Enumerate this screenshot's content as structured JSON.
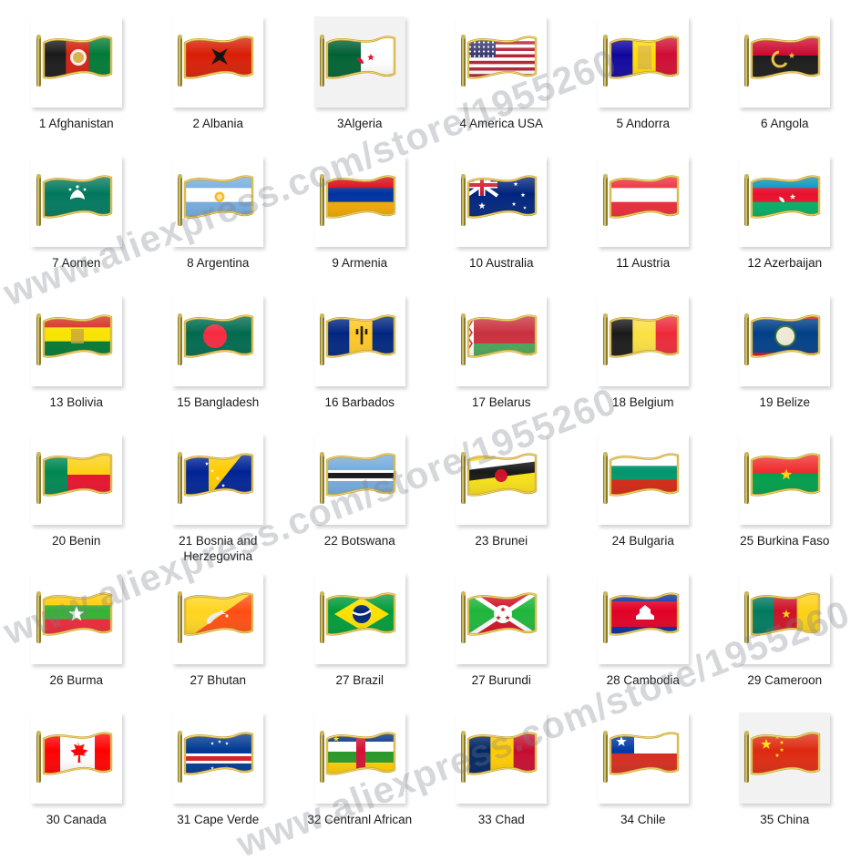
{
  "page": {
    "title": "Flag Lapel Pin Catalog",
    "columns": 6,
    "rows": 6,
    "tile_background": "#ffffff",
    "label_color": "#1b1b1b",
    "page_background": "#ffffff"
  },
  "watermark": {
    "text": "www.aliexpress.com/store/1955260",
    "color": "#7b7e8c",
    "opacity": "0.30",
    "angle_degrees": -21,
    "repetitions": 3
  },
  "items": [
    {
      "number": "1",
      "name": "Afghanistan",
      "label": "1 Afghanistan",
      "tint": false,
      "flag": "afghanistan"
    },
    {
      "number": "2",
      "name": "Albania",
      "label": "2 Albania",
      "tint": false,
      "flag": "albania"
    },
    {
      "number": "3",
      "name": "Algeria",
      "label": "3Algeria",
      "tint": true,
      "flag": "algeria"
    },
    {
      "number": "4",
      "name": "America USA",
      "label": "4 America USA",
      "tint": false,
      "flag": "usa"
    },
    {
      "number": "5",
      "name": "Andorra",
      "label": "5 Andorra",
      "tint": false,
      "flag": "andorra"
    },
    {
      "number": "6",
      "name": "Angola",
      "label": "6 Angola",
      "tint": false,
      "flag": "angola"
    },
    {
      "number": "7",
      "name": "Aomen",
      "label": "7 Aomen",
      "tint": false,
      "flag": "macau"
    },
    {
      "number": "8",
      "name": "Argentina",
      "label": "8 Argentina",
      "tint": false,
      "flag": "argentina"
    },
    {
      "number": "9",
      "name": "Armenia",
      "label": "9 Armenia",
      "tint": false,
      "flag": "armenia"
    },
    {
      "number": "10",
      "name": "Australia",
      "label": "10 Australia",
      "tint": false,
      "flag": "australia"
    },
    {
      "number": "11",
      "name": "Austria",
      "label": "11 Austria",
      "tint": false,
      "flag": "austria"
    },
    {
      "number": "12",
      "name": "Azerbaijan",
      "label": "12 Azerbaijan",
      "tint": false,
      "flag": "azerbaijan"
    },
    {
      "number": "13",
      "name": "Bolivia",
      "label": "13 Bolivia",
      "tint": false,
      "flag": "bolivia"
    },
    {
      "number": "15",
      "name": "Bangladesh",
      "label": "15 Bangladesh",
      "tint": false,
      "flag": "bangladesh"
    },
    {
      "number": "16",
      "name": "Barbados",
      "label": "16 Barbados",
      "tint": false,
      "flag": "barbados"
    },
    {
      "number": "17",
      "name": "Belarus",
      "label": "17 Belarus",
      "tint": false,
      "flag": "belarus"
    },
    {
      "number": "18",
      "name": "Belgium",
      "label": "18 Belgium",
      "tint": false,
      "flag": "belgium"
    },
    {
      "number": "19",
      "name": "Belize",
      "label": "19 Belize",
      "tint": false,
      "flag": "belize"
    },
    {
      "number": "20",
      "name": "Benin",
      "label": "20 Benin",
      "tint": false,
      "flag": "benin"
    },
    {
      "number": "21",
      "name": "Bosnia and Herzegovina",
      "label": "21 Bosnia and Herzegovina",
      "tint": false,
      "flag": "bosnia"
    },
    {
      "number": "22",
      "name": "Botswana",
      "label": "22 Botswana",
      "tint": false,
      "flag": "botswana"
    },
    {
      "number": "23",
      "name": "Brunei",
      "label": "23 Brunei",
      "tint": false,
      "flag": "brunei"
    },
    {
      "number": "24",
      "name": "Bulgaria",
      "label": "24 Bulgaria",
      "tint": false,
      "flag": "bulgaria"
    },
    {
      "number": "25",
      "name": "Burkina Faso",
      "label": "25 Burkina Faso",
      "tint": false,
      "flag": "burkinafaso"
    },
    {
      "number": "26",
      "name": "Burma",
      "label": "26 Burma",
      "tint": false,
      "flag": "burma"
    },
    {
      "number": "27",
      "name": "Bhutan",
      "label": "27 Bhutan",
      "tint": false,
      "flag": "bhutan"
    },
    {
      "number": "27",
      "name": "Brazil",
      "label": "27 Brazil",
      "tint": false,
      "flag": "brazil"
    },
    {
      "number": "27",
      "name": "Burundi",
      "label": "27 Burundi",
      "tint": false,
      "flag": "burundi"
    },
    {
      "number": "28",
      "name": "Cambodia",
      "label": "28 Cambodia",
      "tint": false,
      "flag": "cambodia"
    },
    {
      "number": "29",
      "name": "Cameroon",
      "label": "29 Cameroon",
      "tint": false,
      "flag": "cameroon"
    },
    {
      "number": "30",
      "name": "Canada",
      "label": "30 Canada",
      "tint": false,
      "flag": "canada"
    },
    {
      "number": "31",
      "name": "Cape Verde",
      "label": "31 Cape Verde",
      "tint": false,
      "flag": "capeverde"
    },
    {
      "number": "32",
      "name": "Centranl African",
      "label": "32 Centranl African",
      "tint": false,
      "flag": "centralafrican"
    },
    {
      "number": "33",
      "name": "Chad",
      "label": "33 Chad",
      "tint": false,
      "flag": "chad"
    },
    {
      "number": "34",
      "name": "Chile",
      "label": "34 Chile",
      "tint": false,
      "flag": "chile"
    },
    {
      "number": "35",
      "name": "China",
      "label": "35 China",
      "tint": true,
      "flag": "china"
    }
  ]
}
